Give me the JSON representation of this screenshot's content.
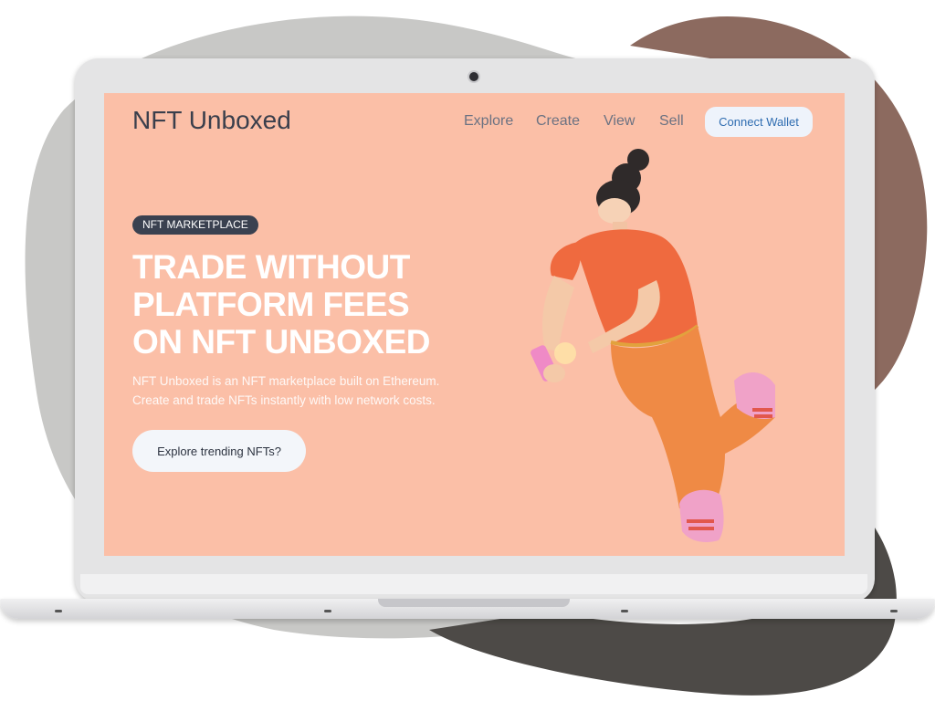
{
  "app": {
    "logo": "NFT Unboxed",
    "nav": [
      "Explore",
      "Create",
      "View",
      "Sell"
    ],
    "connect_wallet": "Connect Wallet"
  },
  "hero": {
    "badge": "NFT MARKETPLACE",
    "headline_lines": [
      "TRADE WITHOUT",
      "PLATFORM FEES",
      "ON NFT UNBOXED"
    ],
    "sub_lines": [
      "NFT Unboxed is an NFT marketplace built on Ethereum.",
      "Create and trade NFTs instantly with low network costs."
    ],
    "cta": "Explore trending NFTs?"
  },
  "colors": {
    "screen_bg": "#fbbfa7",
    "accent_dark": "#3a4150",
    "button_text": "#2f6db1"
  },
  "icons": [
    "webcam-icon",
    "person-illustration"
  ]
}
